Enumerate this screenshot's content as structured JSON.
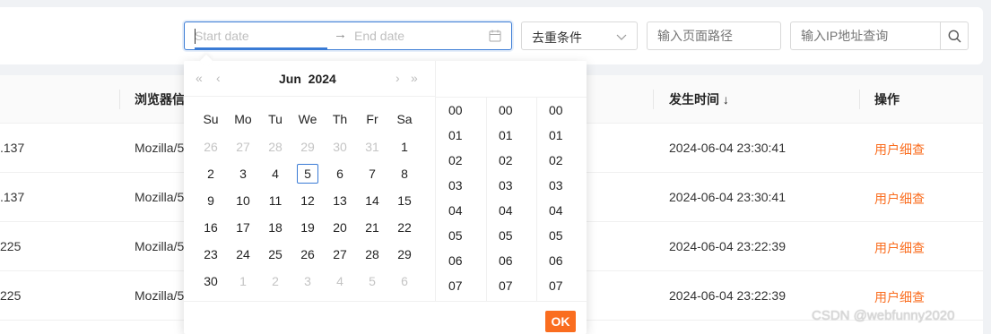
{
  "filters": {
    "date_range": {
      "start_placeholder": "Start date",
      "separator": "→",
      "end_placeholder": "End date"
    },
    "dedupe_select": {
      "value": "去重条件"
    },
    "path_input": {
      "placeholder": "输入页面路径"
    },
    "ip_input": {
      "placeholder": "输入IP地址查询"
    }
  },
  "table": {
    "columns": [
      "浏览器信",
      "发生时间",
      "操作"
    ],
    "sort_indicator": "↓",
    "rows": [
      {
        "ip": ".137",
        "ua": "Mozilla/5",
        "time": "2024-06-04 23:30:41",
        "action": "用户细查"
      },
      {
        "ip": ".137",
        "ua": "Mozilla/5",
        "time": "2024-06-04 23:30:41",
        "action": "用户细查"
      },
      {
        "ip": "225",
        "ua": "Mozilla/5",
        "time": "2024-06-04 23:22:39",
        "action": "用户细查"
      },
      {
        "ip": "225",
        "ua": "Mozilla/5",
        "time": "2024-06-04 23:22:39",
        "action": "用户细查"
      }
    ]
  },
  "datepicker": {
    "month": "Jun",
    "year": "2024",
    "nav": {
      "prev_year": "«",
      "prev_month": "‹",
      "next_month": "›",
      "next_year": "»"
    },
    "weekdays": [
      "Su",
      "Mo",
      "Tu",
      "We",
      "Th",
      "Fr",
      "Sa"
    ],
    "days": [
      [
        "26",
        "27",
        "28",
        "29",
        "30",
        "31",
        "1"
      ],
      [
        "2",
        "3",
        "4",
        "5",
        "6",
        "7",
        "8"
      ],
      [
        "9",
        "10",
        "11",
        "12",
        "13",
        "14",
        "15"
      ],
      [
        "16",
        "17",
        "18",
        "19",
        "20",
        "21",
        "22"
      ],
      [
        "23",
        "24",
        "25",
        "26",
        "27",
        "28",
        "29"
      ],
      [
        "30",
        "1",
        "2",
        "3",
        "4",
        "5",
        "6"
      ]
    ],
    "today": "5",
    "time_columns": [
      [
        "00",
        "01",
        "02",
        "03",
        "04",
        "05",
        "06",
        "07"
      ],
      [
        "00",
        "01",
        "02",
        "03",
        "04",
        "05",
        "06",
        "07"
      ],
      [
        "00",
        "01",
        "02",
        "03",
        "04",
        "05",
        "06",
        "07"
      ]
    ],
    "ok_label": "OK"
  },
  "watermark": "CSDN @webfunny2020",
  "colors": {
    "accent": "#3a7bd5",
    "action": "#fa6d1f"
  }
}
